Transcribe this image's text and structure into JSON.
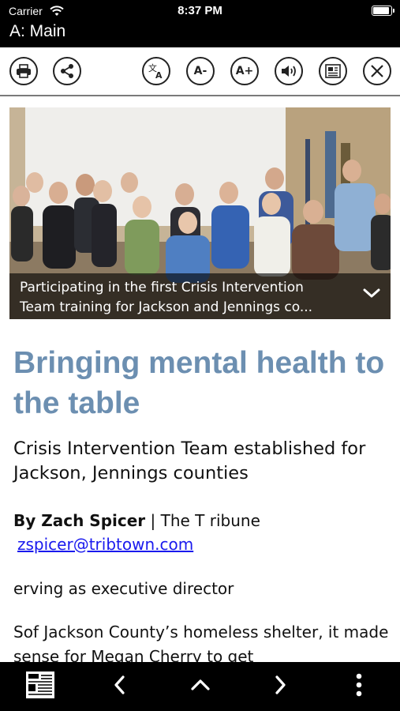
{
  "status_bar": {
    "carrier": "Carrier",
    "time": "8:37 PM"
  },
  "app": {
    "title": "A: Main"
  },
  "toolbar": {
    "font_decrease_label": "A-",
    "font_increase_label": "A+",
    "icons": [
      "print-icon",
      "share-icon",
      "translate-icon",
      "font-decrease-icon",
      "font-increase-icon",
      "speaker-icon",
      "article-view-icon",
      "close-icon"
    ]
  },
  "photo": {
    "caption": "Participating in the first Crisis Intervention Team training for Jackson and Jennings co..."
  },
  "article": {
    "headline": "Bringing mental health to the table",
    "subheadline": "Crisis Intervention Team established for Jackson, Jennings counties",
    "byline_author": "By Zach Spicer",
    "byline_separator": " | The T ribune",
    "email": "zspicer@tribtown.com",
    "paragraph1": "erving as executive director",
    "paragraph2": "Sof Jackson County’s homeless shelter, it made sense for Megan Cherry to get"
  },
  "colors": {
    "headline": "#6c8fb1",
    "link": "#1a1aee",
    "bars": "#000000"
  },
  "bottom_bar": {
    "icons": [
      "newspaper-icon",
      "chevron-left-icon",
      "chevron-up-icon",
      "chevron-right-icon",
      "more-vertical-icon"
    ]
  }
}
